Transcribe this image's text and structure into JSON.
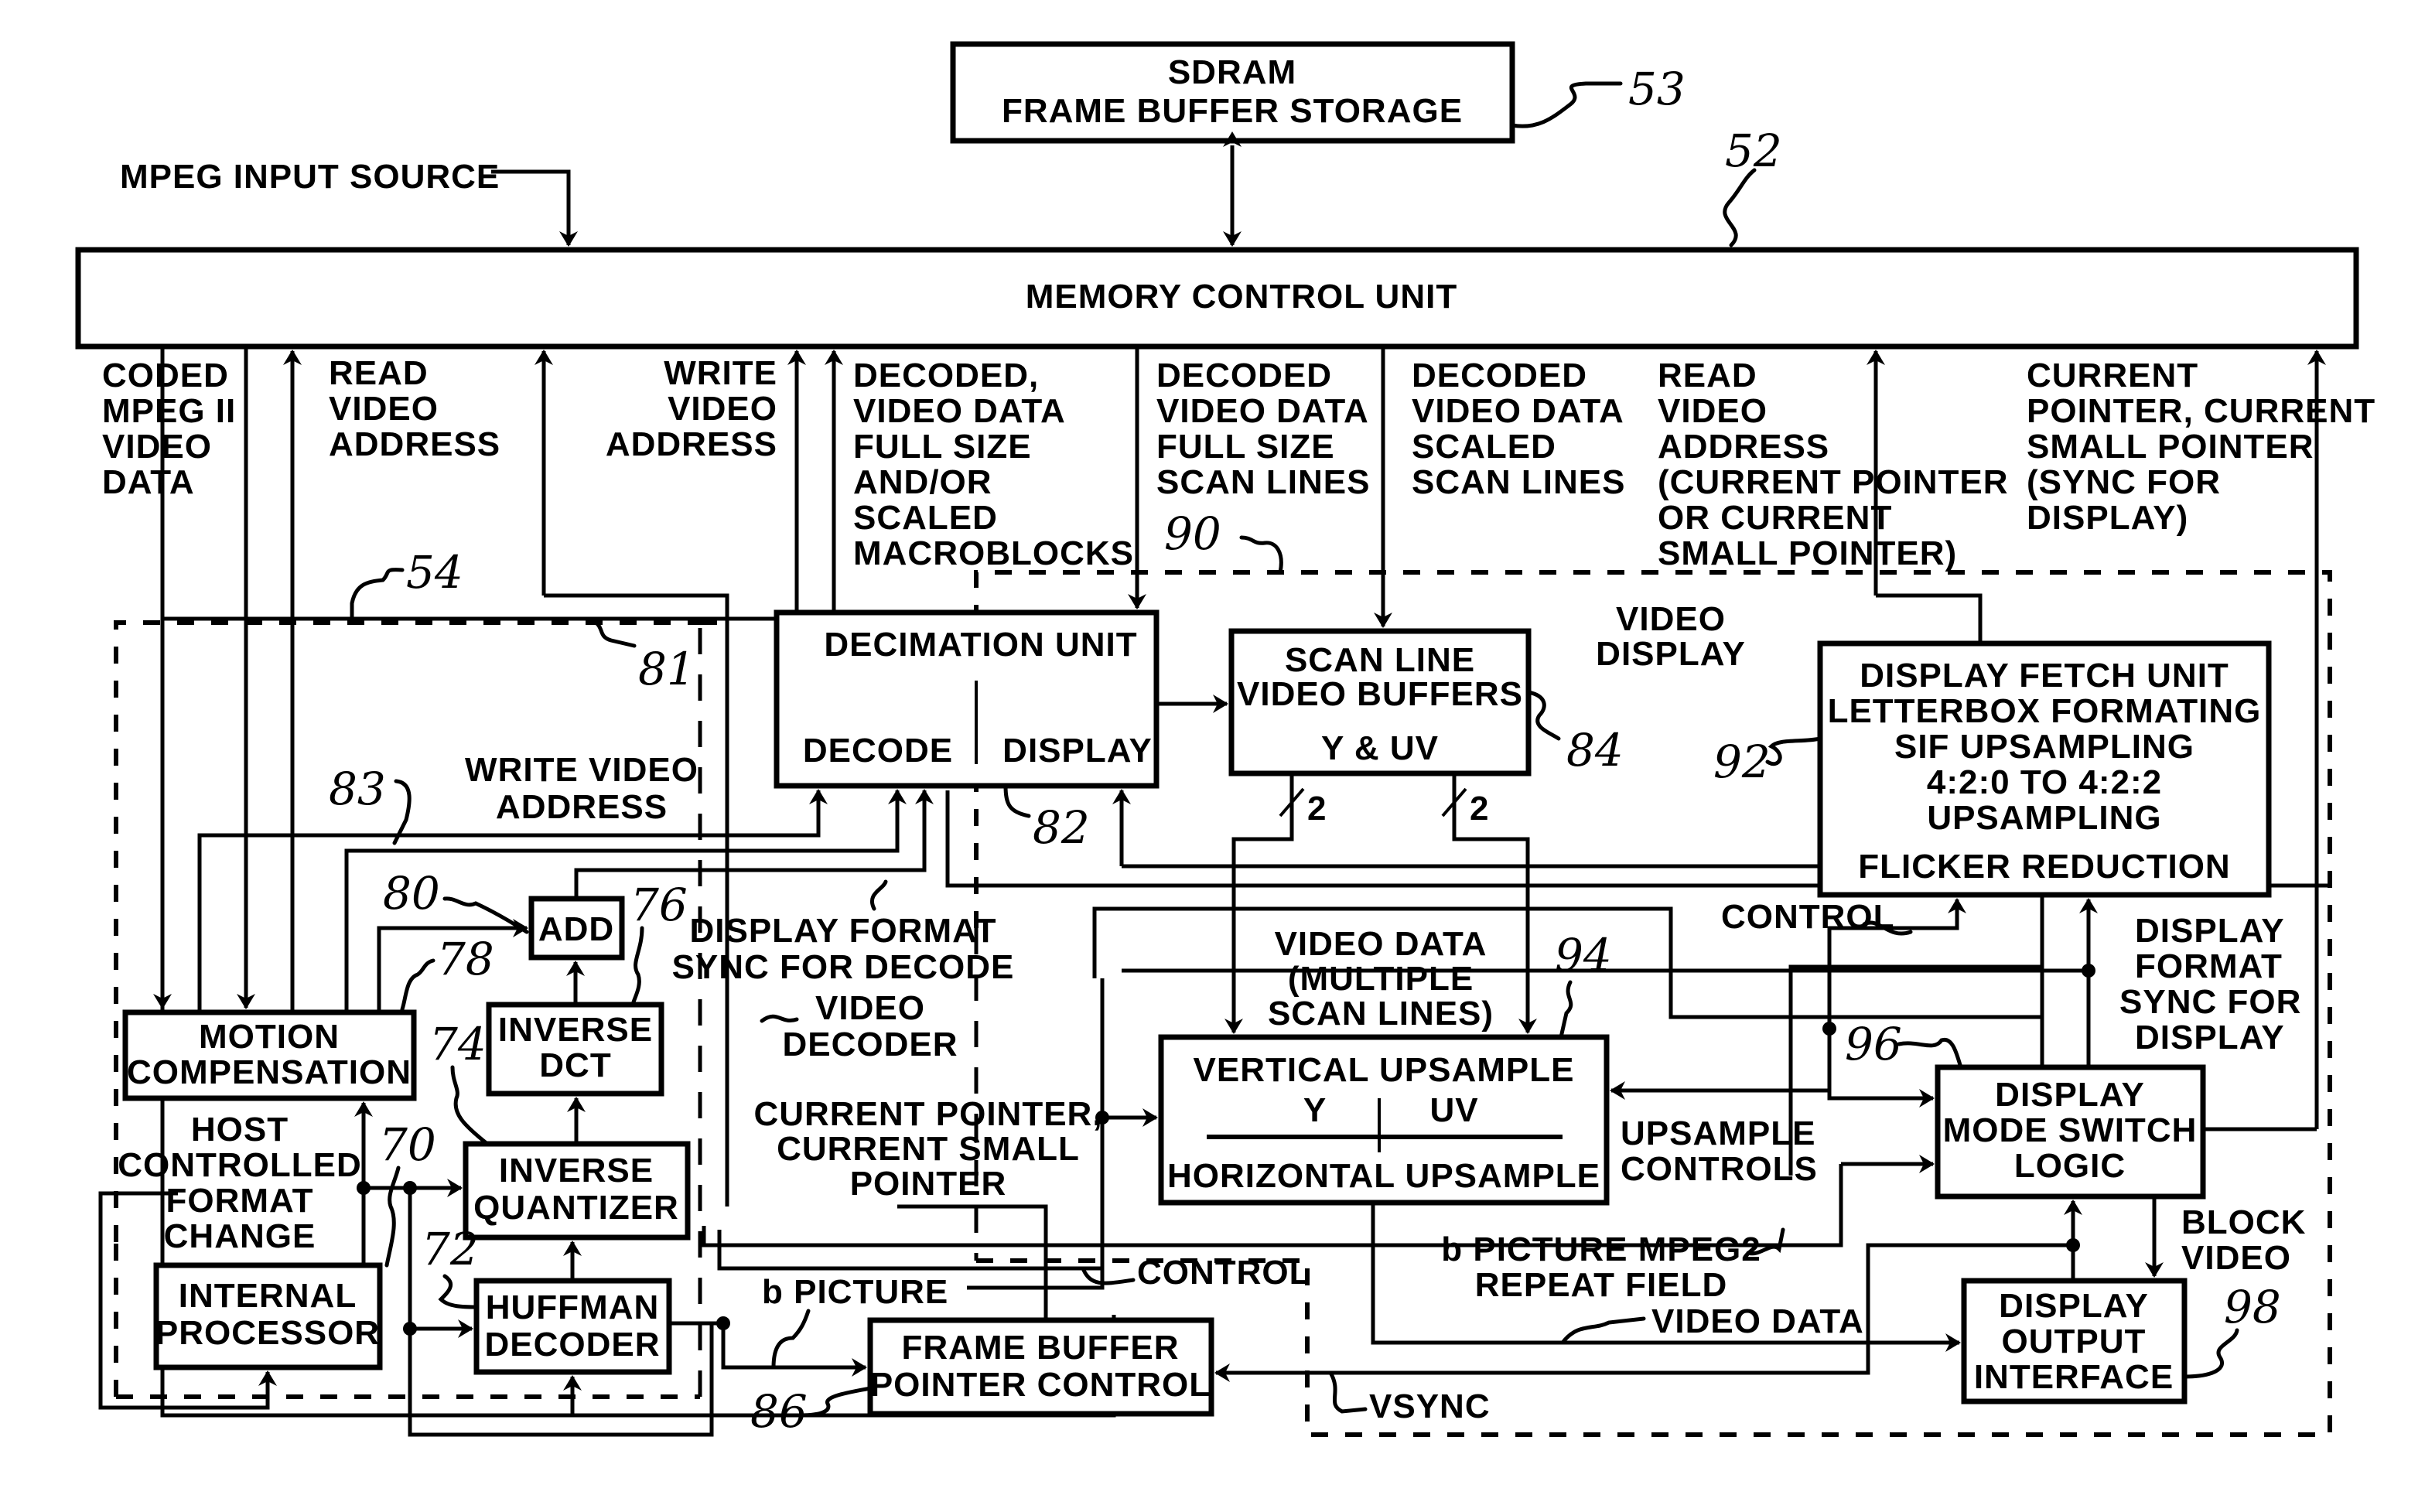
{
  "figure": {
    "type": "block-diagram",
    "colors": {
      "ink": "#000000",
      "paper": "#ffffff"
    }
  },
  "blocks": {
    "sdram": {
      "ref": "53",
      "lines": [
        "SDRAM",
        "FRAME BUFFER STORAGE"
      ]
    },
    "memory_control": {
      "ref": "52",
      "lines": [
        "MEMORY CONTROL UNIT"
      ]
    },
    "decimation": {
      "ref": "82",
      "title": "DECIMATION UNIT",
      "left": "DECODE",
      "right": "DISPLAY"
    },
    "scan_line_buffers": {
      "ref": "84",
      "lines": [
        "SCAN LINE",
        "VIDEO BUFFERS",
        "Y & UV"
      ]
    },
    "display_fetch": {
      "ref": "92",
      "lines": [
        "DISPLAY FETCH UNIT",
        "LETTERBOX FORMATING",
        "SIF UPSAMPLING",
        "4:2:0 TO 4:2:2",
        "UPSAMPLING",
        "FLICKER REDUCTION"
      ]
    },
    "vertical_upsample": {
      "ref": "94",
      "title": "VERTICAL UPSAMPLE",
      "left": "Y",
      "right": "UV",
      "bottom": "HORIZONTAL UPSAMPLE"
    },
    "display_mode_switch": {
      "ref": "96",
      "lines": [
        "DISPLAY",
        "MODE SWITCH",
        "LOGIC"
      ]
    },
    "display_output": {
      "ref": "98",
      "lines": [
        "DISPLAY",
        "OUTPUT",
        "INTERFACE"
      ]
    },
    "frame_buffer_pointer": {
      "ref": "86",
      "lines": [
        "FRAME BUFFER",
        "POINTER CONTROL"
      ]
    },
    "motion_compensation": {
      "ref": "78",
      "lines": [
        "MOTION",
        "COMPENSATION"
      ]
    },
    "add": {
      "ref": "80",
      "lines": [
        "ADD"
      ]
    },
    "inverse_dct": {
      "ref": "76",
      "lines": [
        "INVERSE",
        "DCT"
      ]
    },
    "inverse_quantizer": {
      "ref": "74",
      "lines": [
        "INVERSE",
        "QUANTIZER"
      ]
    },
    "huffman": {
      "ref": "72",
      "lines": [
        "HUFFMAN",
        "DECODER"
      ]
    },
    "internal_processor": {
      "ref": "70",
      "lines": [
        "INTERNAL",
        "PROCESSOR"
      ]
    }
  },
  "regions": {
    "video_decoder": {
      "ref": "54",
      "lines": [
        "VIDEO",
        "DECODER"
      ]
    },
    "video_display": {
      "ref": "90",
      "lines": [
        "VIDEO",
        "DISPLAY"
      ]
    }
  },
  "labels": {
    "mpeg_input": "MPEG INPUT SOURCE",
    "coded_mpeg": [
      "CODED",
      "MPEG II",
      "VIDEO",
      "DATA"
    ],
    "read_video_address": [
      "READ",
      "VIDEO",
      "ADDRESS"
    ],
    "write_video_address_top": [
      "WRITE",
      "VIDEO",
      "ADDRESS"
    ],
    "decoded_macroblocks": [
      "DECODED,",
      "VIDEO DATA",
      "FULL SIZE",
      "AND/OR",
      "SCALED",
      "MACROBLOCKS"
    ],
    "decoded_full_scan": [
      "DECODED",
      "VIDEO DATA",
      "FULL SIZE",
      "SCAN LINES"
    ],
    "decoded_scaled_scan": [
      "DECODED",
      "VIDEO DATA",
      "SCALED",
      "SCAN LINES"
    ],
    "read_video_address_display": [
      "READ",
      "VIDEO",
      "ADDRESS",
      "(CURRENT POINTER",
      "OR CURRENT",
      "SMALL POINTER)"
    ],
    "current_pointer_sync": [
      "CURRENT",
      "POINTER, CURRENT",
      "SMALL POINTER",
      "(SYNC FOR",
      "DISPLAY)"
    ],
    "ref_81": "81",
    "ref_83": "83",
    "write_video_address_mid": [
      "WRITE VIDEO",
      "ADDRESS"
    ],
    "display_format_sync_decode": [
      "DISPLAY FORMAT",
      "SYNC FOR DECODE"
    ],
    "bus_width_1": "2",
    "bus_width_2": "2",
    "video_data_multiple": [
      "VIDEO DATA",
      "(MULTIPLE",
      "SCAN LINES)"
    ],
    "control_top": "CONTROL",
    "display_format_sync_display": [
      "DISPLAY",
      "FORMAT",
      "SYNC FOR",
      "DISPLAY"
    ],
    "host_controlled": [
      "HOST",
      "CONTROLLED",
      "FORMAT",
      "CHANGE"
    ],
    "current_pointer_small": [
      "CURRENT POINTER,",
      "CURRENT SMALL",
      "POINTER"
    ],
    "upsample_controls": [
      "UPSAMPLE",
      "CONTROLS"
    ],
    "block_video": [
      "BLOCK",
      "VIDEO"
    ],
    "control_bottom": "CONTROL",
    "b_picture": "b PICTURE",
    "b_picture_mpeg2": [
      "b PICTURE MPEG2",
      "REPEAT FIELD"
    ],
    "video_data_bottom": "VIDEO DATA",
    "vsync": "VSYNC"
  }
}
